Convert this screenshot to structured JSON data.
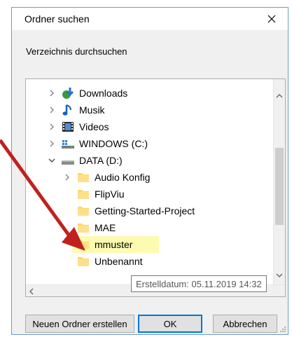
{
  "dialog": {
    "title": "Ordner suchen",
    "close_label": "×",
    "subtitle": "Verzeichnis durchsuchen"
  },
  "tree": {
    "items": [
      {
        "label": "Downloads",
        "icon": "downloads-icon",
        "expand": "collapsed"
      },
      {
        "label": "Musik",
        "icon": "music-note-icon",
        "expand": "collapsed"
      },
      {
        "label": "Videos",
        "icon": "video-film-icon",
        "expand": "collapsed"
      },
      {
        "label": "WINDOWS (C:)",
        "icon": "windows-drive-icon",
        "expand": "collapsed"
      },
      {
        "label": "DATA (D:)",
        "icon": "drive-icon",
        "expand": "expanded"
      },
      {
        "label": "Audio Konfig",
        "icon": "folder-icon",
        "expand": "collapsed"
      },
      {
        "label": "FlipViu",
        "icon": "folder-icon",
        "expand": "none"
      },
      {
        "label": "Getting-Started-Project",
        "icon": "folder-icon",
        "expand": "none"
      },
      {
        "label": "MAE",
        "icon": "folder-icon",
        "expand": "none"
      },
      {
        "label": "mmuster",
        "icon": "folder-icon",
        "expand": "none",
        "highlighted": true
      },
      {
        "label": "Unbenannt",
        "icon": "folder-icon",
        "expand": "none"
      }
    ],
    "tooltip": "Erstelldatum: 05.11.2019 14:32"
  },
  "buttons": {
    "new_folder": "Neuen Ordner erstellen",
    "ok": "OK",
    "cancel": "Abbrechen"
  },
  "colors": {
    "highlight": "#fdfbb0",
    "selection": "#cce8ff",
    "folder": "#ffd766",
    "annotation_arrow": "#c0211f",
    "accent": "#0078d7"
  }
}
